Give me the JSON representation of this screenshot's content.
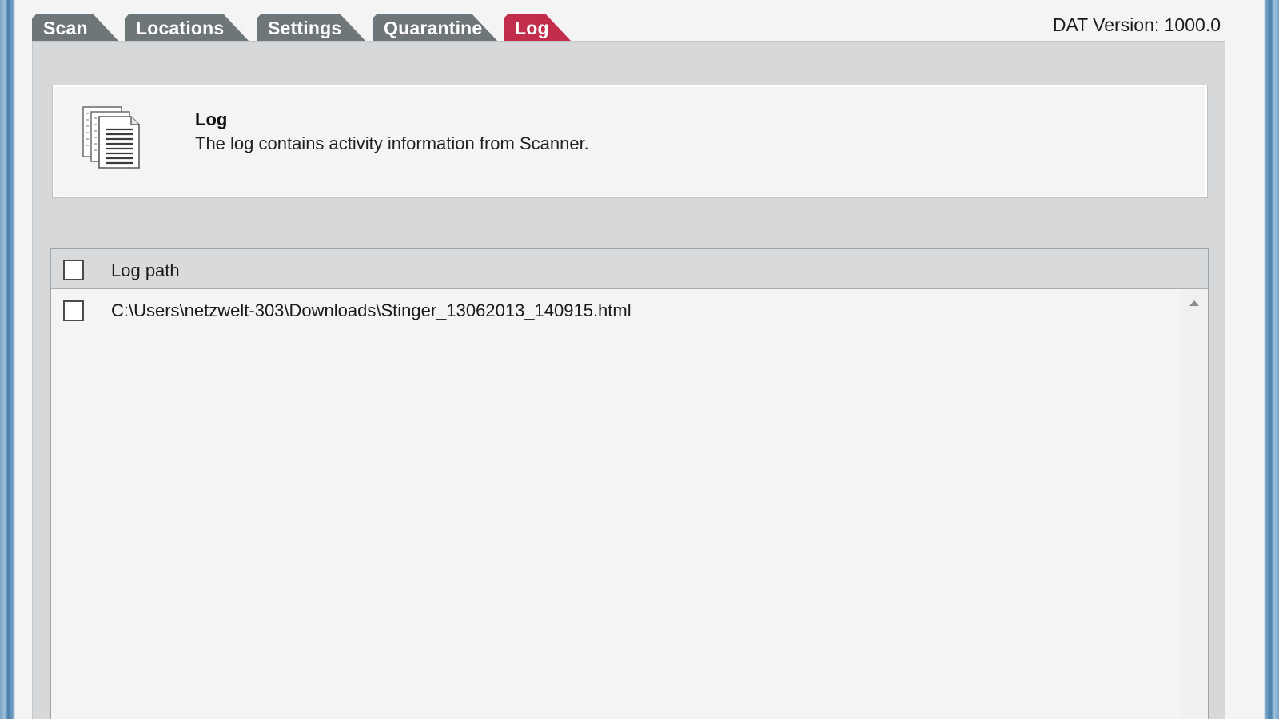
{
  "tabs": [
    {
      "label": "Scan",
      "active": false
    },
    {
      "label": "Locations",
      "active": false
    },
    {
      "label": "Settings",
      "active": false
    },
    {
      "label": "Quarantine",
      "active": false
    },
    {
      "label": "Log",
      "active": true
    }
  ],
  "dat_version": "DAT Version: 1000.0",
  "info": {
    "icon": "document-stack-icon",
    "title": "Log",
    "description": "The log contains activity information from Scanner."
  },
  "log_list": {
    "header": "Log path",
    "header_checked": false,
    "rows": [
      {
        "path": "C:\\Users\\netzwelt-303\\Downloads\\Stinger_13062013_140915.html",
        "checked": false
      }
    ]
  },
  "colors": {
    "active_tab": "#c12d4a",
    "inactive_tab": "#6f7679",
    "panel": "#d6d8d9"
  }
}
